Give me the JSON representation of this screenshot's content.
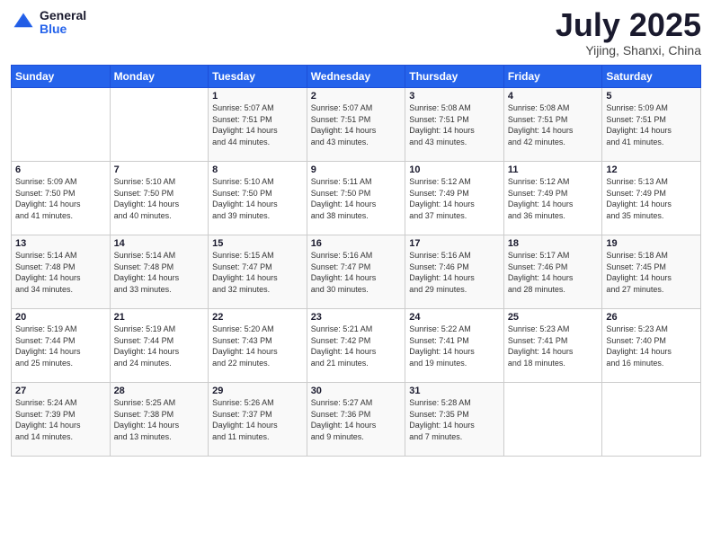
{
  "header": {
    "logo_general": "General",
    "logo_blue": "Blue",
    "month_year": "July 2025",
    "location": "Yijing, Shanxi, China"
  },
  "weekdays": [
    "Sunday",
    "Monday",
    "Tuesday",
    "Wednesday",
    "Thursday",
    "Friday",
    "Saturday"
  ],
  "weeks": [
    [
      {
        "day": "",
        "info": ""
      },
      {
        "day": "",
        "info": ""
      },
      {
        "day": "1",
        "info": "Sunrise: 5:07 AM\nSunset: 7:51 PM\nDaylight: 14 hours\nand 44 minutes."
      },
      {
        "day": "2",
        "info": "Sunrise: 5:07 AM\nSunset: 7:51 PM\nDaylight: 14 hours\nand 43 minutes."
      },
      {
        "day": "3",
        "info": "Sunrise: 5:08 AM\nSunset: 7:51 PM\nDaylight: 14 hours\nand 43 minutes."
      },
      {
        "day": "4",
        "info": "Sunrise: 5:08 AM\nSunset: 7:51 PM\nDaylight: 14 hours\nand 42 minutes."
      },
      {
        "day": "5",
        "info": "Sunrise: 5:09 AM\nSunset: 7:51 PM\nDaylight: 14 hours\nand 41 minutes."
      }
    ],
    [
      {
        "day": "6",
        "info": "Sunrise: 5:09 AM\nSunset: 7:50 PM\nDaylight: 14 hours\nand 41 minutes."
      },
      {
        "day": "7",
        "info": "Sunrise: 5:10 AM\nSunset: 7:50 PM\nDaylight: 14 hours\nand 40 minutes."
      },
      {
        "day": "8",
        "info": "Sunrise: 5:10 AM\nSunset: 7:50 PM\nDaylight: 14 hours\nand 39 minutes."
      },
      {
        "day": "9",
        "info": "Sunrise: 5:11 AM\nSunset: 7:50 PM\nDaylight: 14 hours\nand 38 minutes."
      },
      {
        "day": "10",
        "info": "Sunrise: 5:12 AM\nSunset: 7:49 PM\nDaylight: 14 hours\nand 37 minutes."
      },
      {
        "day": "11",
        "info": "Sunrise: 5:12 AM\nSunset: 7:49 PM\nDaylight: 14 hours\nand 36 minutes."
      },
      {
        "day": "12",
        "info": "Sunrise: 5:13 AM\nSunset: 7:49 PM\nDaylight: 14 hours\nand 35 minutes."
      }
    ],
    [
      {
        "day": "13",
        "info": "Sunrise: 5:14 AM\nSunset: 7:48 PM\nDaylight: 14 hours\nand 34 minutes."
      },
      {
        "day": "14",
        "info": "Sunrise: 5:14 AM\nSunset: 7:48 PM\nDaylight: 14 hours\nand 33 minutes."
      },
      {
        "day": "15",
        "info": "Sunrise: 5:15 AM\nSunset: 7:47 PM\nDaylight: 14 hours\nand 32 minutes."
      },
      {
        "day": "16",
        "info": "Sunrise: 5:16 AM\nSunset: 7:47 PM\nDaylight: 14 hours\nand 30 minutes."
      },
      {
        "day": "17",
        "info": "Sunrise: 5:16 AM\nSunset: 7:46 PM\nDaylight: 14 hours\nand 29 minutes."
      },
      {
        "day": "18",
        "info": "Sunrise: 5:17 AM\nSunset: 7:46 PM\nDaylight: 14 hours\nand 28 minutes."
      },
      {
        "day": "19",
        "info": "Sunrise: 5:18 AM\nSunset: 7:45 PM\nDaylight: 14 hours\nand 27 minutes."
      }
    ],
    [
      {
        "day": "20",
        "info": "Sunrise: 5:19 AM\nSunset: 7:44 PM\nDaylight: 14 hours\nand 25 minutes."
      },
      {
        "day": "21",
        "info": "Sunrise: 5:19 AM\nSunset: 7:44 PM\nDaylight: 14 hours\nand 24 minutes."
      },
      {
        "day": "22",
        "info": "Sunrise: 5:20 AM\nSunset: 7:43 PM\nDaylight: 14 hours\nand 22 minutes."
      },
      {
        "day": "23",
        "info": "Sunrise: 5:21 AM\nSunset: 7:42 PM\nDaylight: 14 hours\nand 21 minutes."
      },
      {
        "day": "24",
        "info": "Sunrise: 5:22 AM\nSunset: 7:41 PM\nDaylight: 14 hours\nand 19 minutes."
      },
      {
        "day": "25",
        "info": "Sunrise: 5:23 AM\nSunset: 7:41 PM\nDaylight: 14 hours\nand 18 minutes."
      },
      {
        "day": "26",
        "info": "Sunrise: 5:23 AM\nSunset: 7:40 PM\nDaylight: 14 hours\nand 16 minutes."
      }
    ],
    [
      {
        "day": "27",
        "info": "Sunrise: 5:24 AM\nSunset: 7:39 PM\nDaylight: 14 hours\nand 14 minutes."
      },
      {
        "day": "28",
        "info": "Sunrise: 5:25 AM\nSunset: 7:38 PM\nDaylight: 14 hours\nand 13 minutes."
      },
      {
        "day": "29",
        "info": "Sunrise: 5:26 AM\nSunset: 7:37 PM\nDaylight: 14 hours\nand 11 minutes."
      },
      {
        "day": "30",
        "info": "Sunrise: 5:27 AM\nSunset: 7:36 PM\nDaylight: 14 hours\nand 9 minutes."
      },
      {
        "day": "31",
        "info": "Sunrise: 5:28 AM\nSunset: 7:35 PM\nDaylight: 14 hours\nand 7 minutes."
      },
      {
        "day": "",
        "info": ""
      },
      {
        "day": "",
        "info": ""
      }
    ]
  ]
}
